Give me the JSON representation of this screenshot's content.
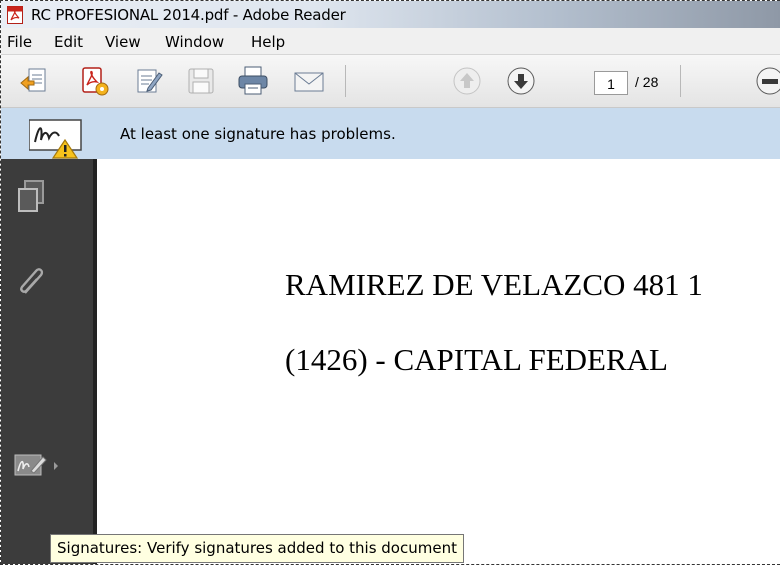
{
  "window": {
    "title": "RC PROFESIONAL 2014.pdf - Adobe Reader"
  },
  "menu": {
    "items": [
      "File",
      "Edit",
      "View",
      "Window",
      "Help"
    ]
  },
  "toolbar": {
    "page_current": "1",
    "page_total": "/ 28",
    "icons": [
      "open-icon",
      "create-pdf-icon",
      "edit-icon",
      "save-icon",
      "print-icon",
      "email-icon",
      "page-up-icon",
      "page-down-icon",
      "zoom-out-icon"
    ]
  },
  "notice": {
    "message": "At least one signature has problems."
  },
  "sidenav": {
    "icons": [
      "pages-icon",
      "attachments-icon",
      "signatures-icon"
    ]
  },
  "document": {
    "line1": "RAMIREZ DE VELAZCO 481 1",
    "line2": "(1426) - CAPITAL FEDERAL"
  },
  "tooltip": {
    "text": "Signatures: Verify signatures added to this document"
  },
  "colors": {
    "notice_bg": "#c8dbee",
    "sidenav_bg": "#3c3c3c",
    "tooltip_bg": "#ffffe1"
  }
}
